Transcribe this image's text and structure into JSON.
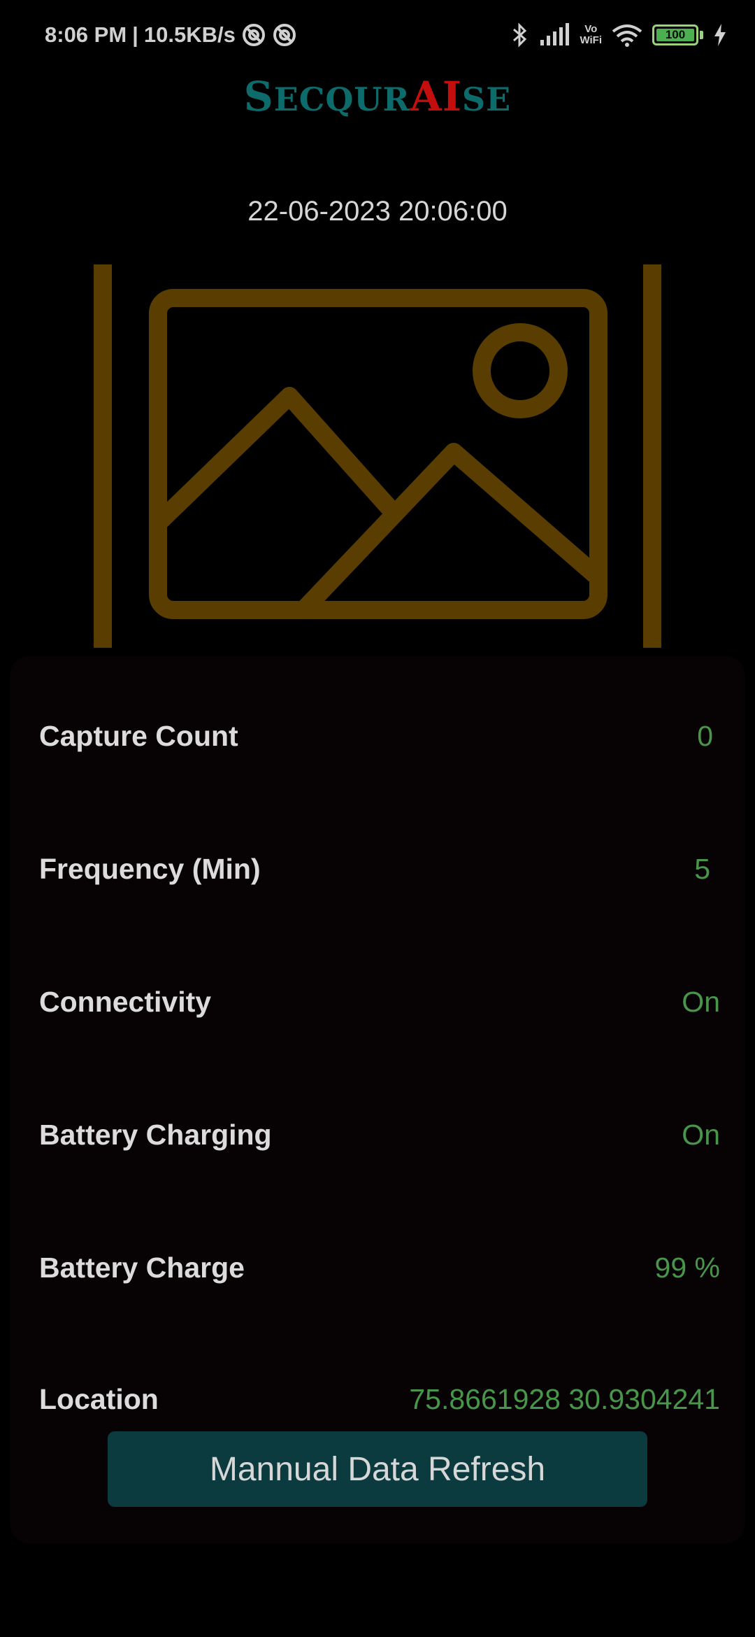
{
  "status_bar": {
    "time": "8:06 PM",
    "separator": "|",
    "network_speed": "10.5KB/s",
    "vowifi_line1": "Vo",
    "vowifi_line2": "WiFi",
    "battery_level": "100",
    "icons": [
      "data-saver-icon",
      "data-saver-icon",
      "bluetooth-icon",
      "signal-icon",
      "vowifi-icon",
      "wifi-icon",
      "battery-icon",
      "charging-icon"
    ]
  },
  "logo": {
    "part1": "S",
    "part2": "ECQUR",
    "part3": "AI",
    "part4": "SE",
    "teal_color": "#0d6b6b",
    "red_color": "#c40d0d"
  },
  "datetime": "22-06-2023 20:06:00",
  "image_placeholder": {
    "icon": "image-placeholder-icon",
    "color": "#5a3d00"
  },
  "info": {
    "rows": [
      {
        "label": "Capture Count",
        "value": "0"
      },
      {
        "label": "Frequency (Min)",
        "value": "5"
      },
      {
        "label": "Connectivity",
        "value": "On"
      },
      {
        "label": "Battery Charging",
        "value": "On"
      },
      {
        "label": "Battery Charge",
        "value": "99 %"
      },
      {
        "label": "Location",
        "value": "75.8661928 30.9304241"
      }
    ]
  },
  "refresh_button": {
    "label": "Mannual Data Refresh"
  },
  "colors": {
    "background": "#000000",
    "card": "#070305",
    "value_green": "#48964a",
    "button": "#0b3b3e"
  }
}
